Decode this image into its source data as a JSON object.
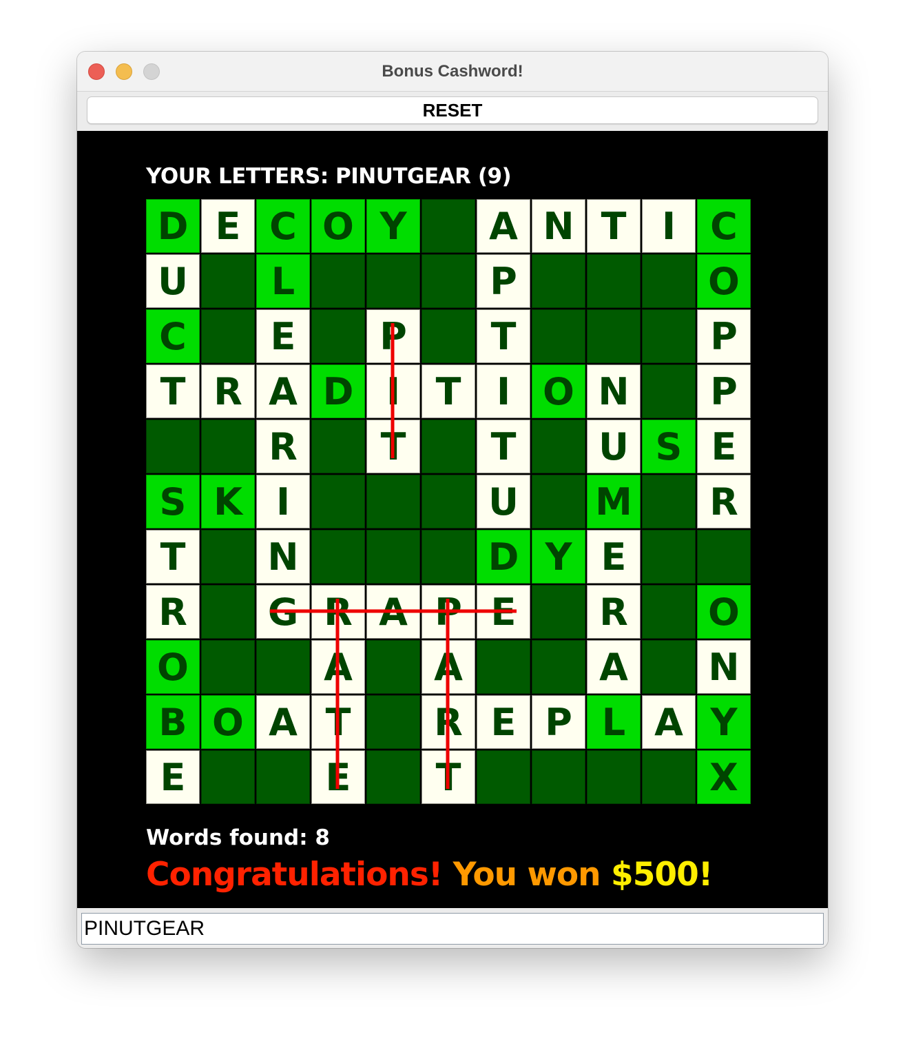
{
  "window": {
    "title": "Bonus Cashword!"
  },
  "toolbar": {
    "reset_label": "RESET"
  },
  "game": {
    "letters_label": "YOUR LETTERS: PINUTGEAR (9)",
    "words_found": "Words found: 8",
    "congrats": {
      "part1": "Congratulations!",
      "part2": " You won ",
      "part3": "$500!",
      "colors": [
        "#ff2200",
        "#ff9900",
        "#ffee00"
      ]
    },
    "grid": [
      [
        "D#",
        "E",
        "C#",
        "O#",
        "Y#",
        "",
        "A",
        "N",
        "T",
        "I",
        "C#"
      ],
      [
        "U",
        "",
        "L#",
        "",
        "",
        "",
        "P",
        "",
        "",
        "",
        "O#"
      ],
      [
        "C#",
        "",
        "E",
        "",
        "P",
        "",
        "T",
        "",
        "",
        "",
        "P"
      ],
      [
        "T",
        "R",
        "A",
        "D#",
        "I",
        "T",
        "I",
        "O#",
        "N",
        "",
        "P"
      ],
      [
        "",
        "",
        "R",
        "",
        "T",
        "",
        "T",
        "",
        "U",
        "S#",
        "E"
      ],
      [
        "S#",
        "K#",
        "I",
        "",
        "",
        "",
        "U",
        "",
        "M#",
        "",
        "R"
      ],
      [
        "T",
        "",
        "N",
        "",
        "",
        "",
        "D#",
        "Y#",
        "E",
        "",
        ""
      ],
      [
        "R",
        "",
        "G",
        "R",
        "A",
        "P",
        "E",
        "",
        "R",
        "",
        "O#"
      ],
      [
        "O#",
        "",
        "",
        "A",
        "",
        "A",
        "",
        "",
        "A",
        "",
        "N"
      ],
      [
        "B#",
        "O#",
        "A",
        "T",
        "",
        "R",
        "E",
        "P",
        "L#",
        "A",
        "Y#"
      ],
      [
        "E",
        "",
        "",
        "E",
        "",
        "T",
        "",
        "",
        "",
        "",
        "X#"
      ]
    ],
    "strikes": [
      {
        "word": "PIT",
        "row": 2,
        "col": 4,
        "dir": "down",
        "len": 3
      },
      {
        "word": "GRAPE",
        "row": 7,
        "col": 2,
        "dir": "across",
        "len": 5
      },
      {
        "word": "RATE",
        "row": 7,
        "col": 3,
        "dir": "down",
        "len": 4
      },
      {
        "word": "PART",
        "row": 7,
        "col": 5,
        "dir": "down",
        "len": 4
      }
    ],
    "colors": {
      "blank": "#005a00",
      "open": "#fffff0",
      "hit": "#00dd00",
      "letter": "#004400",
      "strike": "#ee0000"
    }
  },
  "input": {
    "value": "PINUTGEAR"
  }
}
